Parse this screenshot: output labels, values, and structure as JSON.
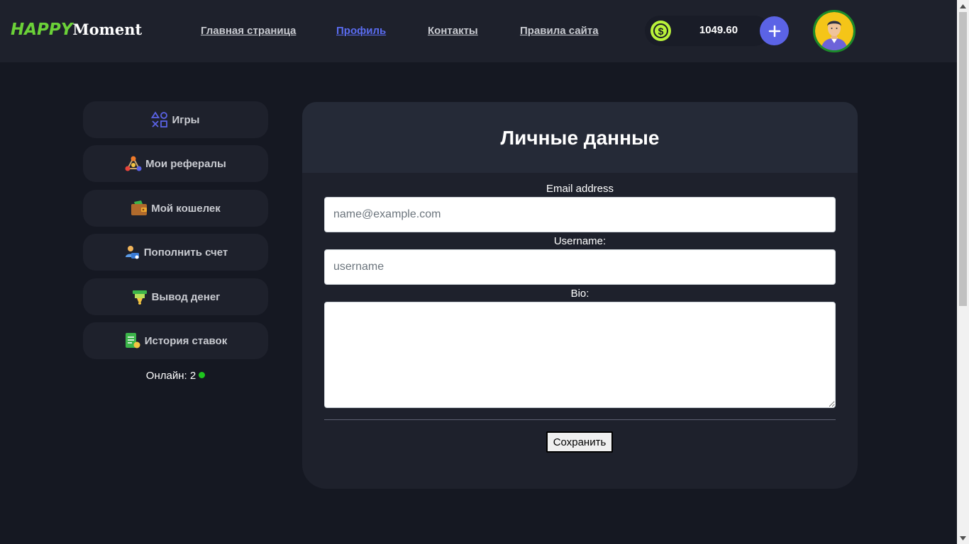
{
  "header": {
    "logo": {
      "part1": "HAPPY",
      "part2": "Moment"
    },
    "nav": [
      {
        "label": "Главная страница",
        "active": false
      },
      {
        "label": "Профиль",
        "active": true
      },
      {
        "label": "Контакты",
        "active": false
      },
      {
        "label": "Правила сайта",
        "active": false
      }
    ],
    "balance": {
      "currency_icon": "dollar-coin-icon",
      "value": "1049.60"
    },
    "add_funds_icon": "plus-icon",
    "avatar_icon": "user-avatar"
  },
  "sidebar": {
    "items": [
      {
        "label": "Игры",
        "icon": "games-icon"
      },
      {
        "label": "Мои рефералы",
        "icon": "referrals-icon"
      },
      {
        "label": "Мой кошелек",
        "icon": "wallet-icon"
      },
      {
        "label": "Пополнить счет",
        "icon": "deposit-icon"
      },
      {
        "label": "Вывод денег",
        "icon": "withdraw-icon"
      },
      {
        "label": "История ставок",
        "icon": "bet-history-icon"
      }
    ],
    "online": {
      "label": "Онлайн: 2"
    }
  },
  "profile": {
    "title": "Личные данные",
    "email": {
      "label": "Email address",
      "placeholder": "name@example.com",
      "value": ""
    },
    "username": {
      "label": "Username:",
      "placeholder": "username",
      "value": ""
    },
    "bio": {
      "label": "Bio:",
      "value": ""
    },
    "save_label": "Сохранить"
  },
  "colors": {
    "background": "#151822",
    "header": "#1e212c",
    "accent": "#5b63e6",
    "logo_green": "#6bd138",
    "coin": "#b9f23a",
    "online": "#1ec51e"
  }
}
